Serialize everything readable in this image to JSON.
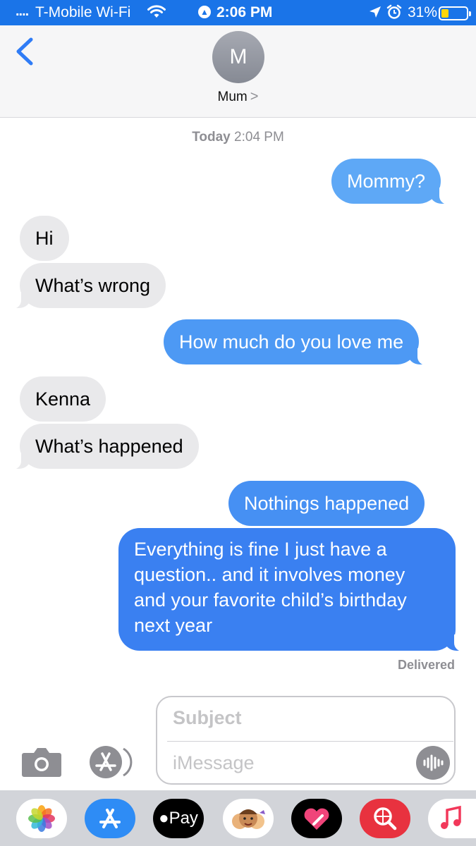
{
  "status_bar": {
    "signal": "....",
    "carrier": "T-Mobile Wi-Fi",
    "time": "2:06 PM",
    "battery": "31%",
    "battery_level": 0.31,
    "battery_color": "#ffd60a",
    "background": "#1a74e8"
  },
  "header": {
    "avatar_initial": "M",
    "contact_name": "Mum",
    "chevron": ">"
  },
  "timestamp": {
    "day": "Today",
    "time": "2:04 PM"
  },
  "messages": [
    {
      "from": "me",
      "text": "Mommy?"
    },
    {
      "from": "them",
      "text": "Hi"
    },
    {
      "from": "them",
      "text": "What’s wrong"
    },
    {
      "from": "me",
      "text": "How much do you love me"
    },
    {
      "from": "them",
      "text": "Kenna"
    },
    {
      "from": "them",
      "text": "What’s happened"
    },
    {
      "from": "me",
      "text": "Nothings happened"
    },
    {
      "from": "me",
      "text": "Everything is fine I just have a question.. and it involves money and your favorite child’s birthday next year"
    }
  ],
  "delivery_status": "Delivered",
  "composer": {
    "subject_placeholder": "Subject",
    "message_placeholder": "iMessage"
  },
  "app_drawer": {
    "apps": [
      "photos-icon",
      "app-store-icon",
      "apple-pay-icon",
      "memoji-icon",
      "digital-touch-icon",
      "web-search-icon",
      "music-icon"
    ],
    "apple_pay_label": "Pay"
  },
  "colors": {
    "sent_bubble": "#3a80f1",
    "received_bubble": "#e9e9eb",
    "accent": "#1a74e8"
  }
}
